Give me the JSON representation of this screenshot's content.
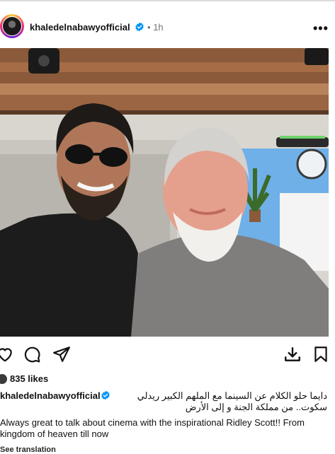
{
  "post": {
    "username": "khaledelnabawyofficial",
    "separator": "•",
    "time": "1h",
    "more_label": "•••"
  },
  "icons": {
    "like": "heart-icon",
    "comment": "comment-icon",
    "share": "share-icon",
    "download": "download-icon",
    "save": "bookmark-icon",
    "verified": "verified-badge-icon"
  },
  "stats": {
    "likes": "835 likes"
  },
  "caption": {
    "username": "khaledelnabawyofficial",
    "arabic_line1": "دايما حلو الكلام عن السينما مع الملهم الكبير ريدلي",
    "arabic_line2": "سكوت.. من مملكة الجنة و إلى الأرض",
    "english": "Always great to talk about cinema with the inspirational Ridley Scott!! From kingdom of heaven till now"
  },
  "see_translation": "See translation",
  "colors": {
    "verified": "#0095f6",
    "muted": "#737373"
  }
}
